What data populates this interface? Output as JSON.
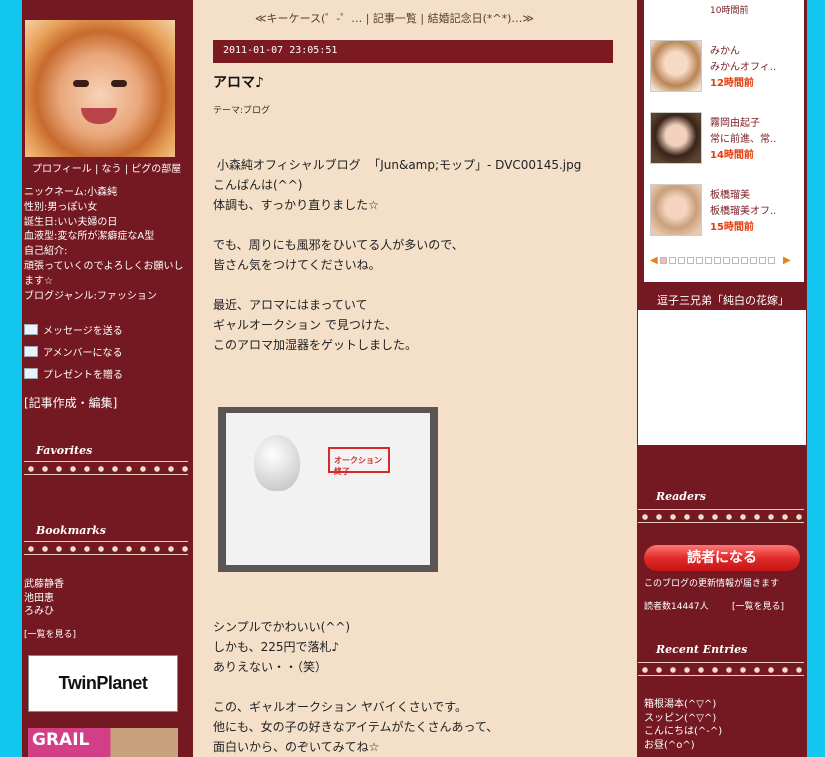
{
  "header": {
    "topnav": "≪キーケース(゜-゜… | 記事一覧 | 結婚記念日(*^*)…≫"
  },
  "left": {
    "nav": "プロフィール | なう | ピグの部屋",
    "profile": [
      "ニックネーム:小森純",
      "性別:男っぽい女",
      "誕生日:いい夫婦の日",
      "血液型:変な所が潔癖症なA型",
      "自己紹介:",
      "頑張っていくのでよろしくお願いします☆",
      "ブログジャンル:ファッション"
    ],
    "actions": [
      "メッセージを送る",
      "アメンバーになる",
      "プレゼントを贈る"
    ],
    "edit": "[記事作成・編集]",
    "favorites_title": "Favorites",
    "bookmarks_title": "Bookmarks",
    "bookmarks": [
      "武藤静香",
      "池田恵",
      "ろみひ"
    ],
    "bookmarks_more": "[一覧を見る]",
    "banner1": "TwinPlanet",
    "banner2": "GRAIL"
  },
  "post": {
    "datetime": "2011-01-07 23:05:51",
    "title": "アロマ♪",
    "theme": "テーマ:ブログ",
    "body": [
      " 小森純オフィシャルブログ  「Jun&amp;モップ」- DVC00145.jpg",
      "こんばんは(^^)",
      "体調も、すっかり直りました☆",
      "",
      "でも、周りにも風邪をひいてる人が多いので、",
      "皆さん気をつけてくださいね。",
      "",
      "最近、アロマにはまっていて",
      "ギャルオークション で見つけた、",
      "このアロマ加湿器をゲットしました。"
    ],
    "photo_label": "オークション終了",
    "body2": [
      "シンプルでかわいい(^^)",
      "しかも、225円で落札♪",
      "ありえない・・（笑）",
      "",
      "この、ギャルオークション ヤバイくさいです。",
      "他にも、女の子の好きなアイテムがたくさんあって、",
      "面白いから、のぞいてみてね☆"
    ]
  },
  "right": {
    "top_time": "10時間前",
    "entries": [
      {
        "name": "みかん",
        "text": "みかんオフィ..",
        "time": "12時間前"
      },
      {
        "name": "霧岡由起子",
        "text": "常に前進、常..",
        "time": "14時間前"
      },
      {
        "name": "板橋瑠美",
        "text": "板橋瑠美オフ..",
        "time": "15時間前"
      }
    ],
    "movie_title": "逗子三兄弟「純白の花嫁」",
    "readers_title": "Readers",
    "readers_button": "読者になる",
    "readers_desc": "このブログの更新情報が届きます",
    "readers_count": "読者数14447人",
    "readers_more": "[一覧を見る]",
    "recent_title": "Recent Entries",
    "recent": [
      "箱根湯本(^▽^)",
      "スッピン(^▽^)",
      "こんにちは(^-^)",
      "お昼(^o^)"
    ]
  }
}
